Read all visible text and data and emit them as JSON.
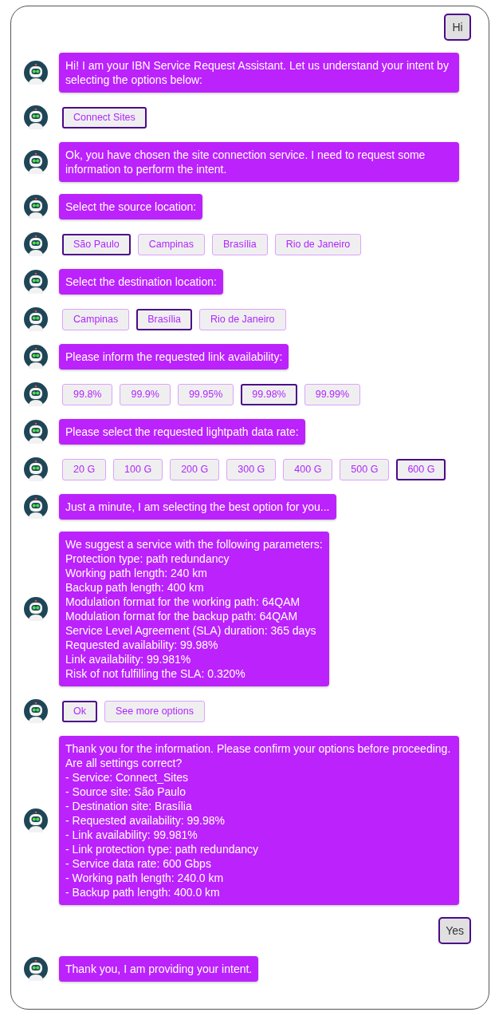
{
  "messages": [
    {
      "kind": "user",
      "text": "Hi"
    },
    {
      "kind": "bot",
      "text": "Hi! I am your IBN Service Request Assistant. Let us understand your intent by selecting the options below:"
    },
    {
      "kind": "options",
      "options": [
        {
          "label": "Connect Sites",
          "selected": true
        }
      ]
    },
    {
      "kind": "bot",
      "text": "Ok, you have chosen the site connection service. I need to request some information to perform the intent."
    },
    {
      "kind": "bot",
      "text": "Select the source location:"
    },
    {
      "kind": "options",
      "options": [
        {
          "label": "São Paulo",
          "selected": true
        },
        {
          "label": "Campinas",
          "selected": false
        },
        {
          "label": "Brasília",
          "selected": false
        },
        {
          "label": "Rio de Janeiro",
          "selected": false
        }
      ]
    },
    {
      "kind": "bot",
      "text": "Select the destination location:"
    },
    {
      "kind": "options",
      "options": [
        {
          "label": "Campinas",
          "selected": false
        },
        {
          "label": "Brasília",
          "selected": true
        },
        {
          "label": "Rio de Janeiro",
          "selected": false
        }
      ]
    },
    {
      "kind": "bot",
      "text": "Please inform the requested link availability:"
    },
    {
      "kind": "options",
      "options": [
        {
          "label": "99.8%",
          "selected": false
        },
        {
          "label": "99.9%",
          "selected": false
        },
        {
          "label": "99.95%",
          "selected": false
        },
        {
          "label": "99.98%",
          "selected": true
        },
        {
          "label": "99.99%",
          "selected": false
        }
      ]
    },
    {
      "kind": "bot",
      "text": "Please select the requested lightpath data rate:"
    },
    {
      "kind": "options",
      "options": [
        {
          "label": "20 G",
          "selected": false
        },
        {
          "label": "100 G",
          "selected": false
        },
        {
          "label": "200 G",
          "selected": false
        },
        {
          "label": "300 G",
          "selected": false
        },
        {
          "label": "400 G",
          "selected": false
        },
        {
          "label": "500 G",
          "selected": false
        },
        {
          "label": "600 G",
          "selected": true
        }
      ]
    },
    {
      "kind": "bot",
      "text": "Just a minute, I am selecting the best option for you..."
    },
    {
      "kind": "bot",
      "text": "We suggest a service with the following parameters:\nProtection type: path redundancy\nWorking path length: 240 km\nBackup path length: 400 km\nModulation format for the working path: 64QAM\nModulation format for the backup path: 64QAM\nService Level Agreement (SLA) duration: 365 days\nRequested availability: 99.98%\nLink availability: 99.981%\nRisk of not fulfilling the SLA: 0.320%"
    },
    {
      "kind": "options",
      "options": [
        {
          "label": "Ok",
          "selected": true
        },
        {
          "label": "See more options",
          "selected": false
        }
      ]
    },
    {
      "kind": "bot",
      "text": "Thank you for the information. Please confirm your options before proceeding. Are all settings correct?\n- Service: Connect_Sites\n- Source site: São Paulo\n- Destination site: Brasília\n- Requested availability: 99.98%\n- Link availability: 99.981%\n- Link protection type: path redundancy\n- Service data rate: 600 Gbps\n- Working path length: 240.0 km\n- Backup path length: 400.0 km"
    },
    {
      "kind": "user",
      "text": "Yes"
    },
    {
      "kind": "bot",
      "text": "Thank you, I am providing your intent."
    }
  ]
}
